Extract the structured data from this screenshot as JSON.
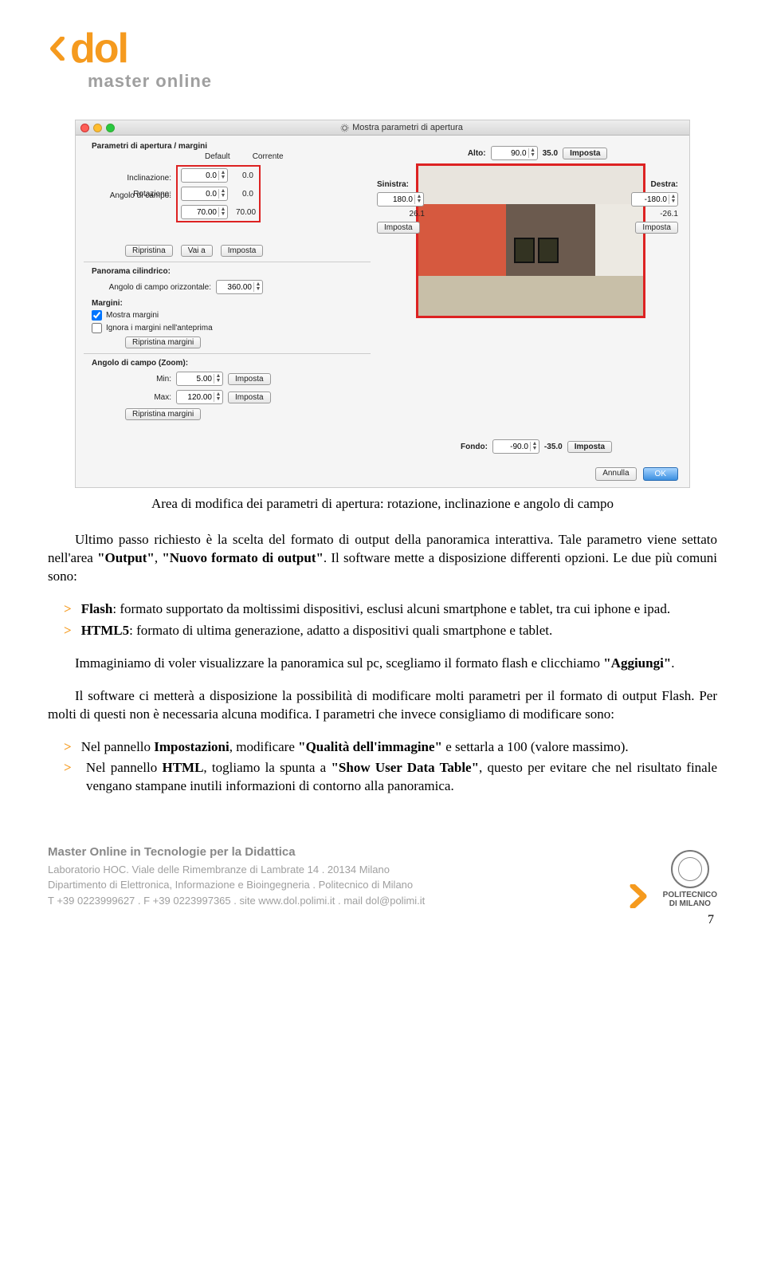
{
  "header": {
    "brand": "dol",
    "tagline": "master online"
  },
  "screenshot": {
    "title": "Mostra parametri di apertura",
    "group_main": "Parametri di apertura / margini",
    "columns": {
      "default": "Default",
      "current": "Corrente"
    },
    "params": {
      "rotazione": {
        "label": "Rotazione:",
        "default": "0.0",
        "current": "0.0"
      },
      "inclinazione": {
        "label": "Inclinazione:",
        "default": "0.0",
        "current": "0.0"
      },
      "angolo": {
        "label": "Angolo di campo:",
        "default": "70.00",
        "current": "70.00"
      }
    },
    "buttons_row1": {
      "ripristina": "Ripristina",
      "vaia": "Vai a",
      "imposta": "Imposta"
    },
    "cilindrico": {
      "title": "Panorama cilindrico:",
      "horiz_label": "Angolo di campo orizzontale:",
      "horiz_val": "360.00",
      "margini_label": "Margini:",
      "mostra": "Mostra margini",
      "ignora": "Ignora i margini nell'anteprima",
      "ripristina_margini": "Ripristina margini"
    },
    "zoom": {
      "title": "Angolo di campo (Zoom):",
      "min_label": "Min:",
      "min_val": "5.00",
      "max_label": "Max:",
      "max_val": "120.00",
      "imposta": "Imposta",
      "ripristina": "Ripristina margini"
    },
    "topbar": {
      "alto_label": "Alto:",
      "alto_val": "90.0",
      "alto_val2": "35.0",
      "imposta": "Imposta"
    },
    "left_side": {
      "label": "Sinistra:",
      "val": "180.0",
      "val2": "26.1",
      "imposta": "Imposta"
    },
    "right_side": {
      "label": "Destra:",
      "val": "-180.0",
      "val2": "-26.1",
      "imposta": "Imposta"
    },
    "fondo": {
      "label": "Fondo:",
      "val": "-90.0",
      "val2": "-35.0",
      "imposta": "Imposta"
    },
    "bottom": {
      "annulla": "Annulla",
      "ok": "OK"
    }
  },
  "caption": "Area di modifica dei parametri di apertura: rotazione, inclinazione e angolo di campo",
  "paragraphs": {
    "p1_a": "Ultimo passo richiesto è la scelta del formato di output della panoramica interattiva. Tale parametro viene settato nell'area ",
    "p1_b": "\"Output\"",
    "p1_c": ", ",
    "p1_d": "\"Nuovo formato di output\"",
    "p1_e": ". Il software mette a disposizione differenti opzioni. Le due più comuni sono:",
    "bullet1_a": "Flash",
    "bullet1_b": ": formato supportato da moltissimi dispositivi, esclusi alcuni smartphone e tablet, tra cui iphone e ipad.",
    "bullet2_a": "HTML5",
    "bullet2_b": ": formato di ultima generazione, adatto a dispositivi quali smartphone e tablet.",
    "p2_a": "Immaginiamo di voler visualizzare la panoramica sul pc, scegliamo il formato flash e clicchiamo ",
    "p2_b": "\"Aggiungi\"",
    "p2_c": ".",
    "p3": "Il software ci metterà a disposizione la possibilità di modificare molti parametri per il formato di output Flash. Per molti di questi non è necessaria alcuna modifica. I parametri che invece consigliamo di modificare sono:",
    "bullet3_a": "Nel pannello ",
    "bullet3_b": "Impostazioni",
    "bullet3_c": ", modificare ",
    "bullet3_d": "\"Qualità dell'immagine\"",
    "bullet3_e": " e settarla a 100 (valore massimo).",
    "bullet4_a": " Nel pannello ",
    "bullet4_b": "HTML",
    "bullet4_c": ", togliamo la spunta a  ",
    "bullet4_d": "\"Show User Data Table\"",
    "bullet4_e": ", questo per evitare che nel risultato finale vengano stampane inutili informazioni di contorno alla panoramica."
  },
  "footer": {
    "title": "Master Online in Tecnologie per la Didattica",
    "line1": "Laboratorio HOC. Viale delle Rimembranze di Lambrate 14 . 20134 Milano",
    "line2": "Dipartimento di Elettronica, Informazione e Bioingegneria . Politecnico di Milano",
    "line3": "T +39 0223999627 . F +39 0223997365 . site  www.dol.polimi.it . mail dol@polimi.it",
    "polimi1": "POLITECNICO",
    "polimi2": "DI MILANO"
  },
  "page_number": "7"
}
